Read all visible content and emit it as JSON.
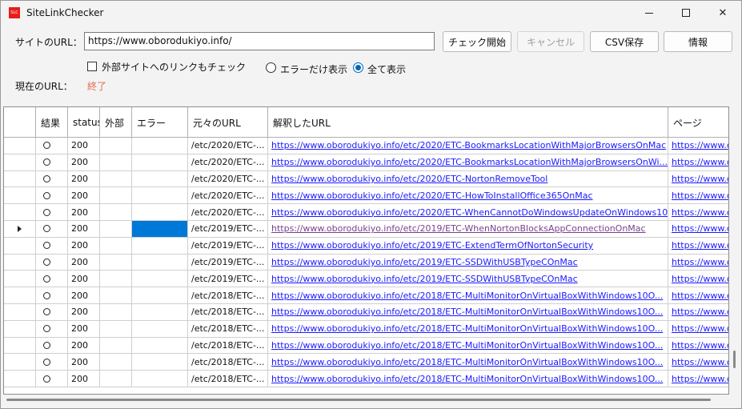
{
  "window": {
    "title": "SiteLinkChecker",
    "icon_text": "SLC"
  },
  "controls": {
    "site_url_label": "サイトのURL：",
    "site_url_value": "https://www.oborodukiyo.info/",
    "buttons": {
      "start": "チェック開始",
      "cancel": "キャンセル",
      "csv": "CSV保存",
      "info": "情報"
    },
    "external_check_label": "外部サイトへのリンクもチェック",
    "external_check_checked": false,
    "radio_errors_only": "エラーだけ表示",
    "radio_show_all": "全て表示",
    "selected_filter": "show_all",
    "current_url_label": "現在のURL：",
    "current_url_value": "終了"
  },
  "grid": {
    "columns": [
      "",
      "結果",
      "status",
      "外部",
      "エラー",
      "元々のURL",
      "解釈したURL",
      "ページ"
    ],
    "rows": [
      {
        "status": "200",
        "orig": "/etc/2020/ETC-...",
        "url": "https://www.oborodukiyo.info/etc/2020/ETC-BookmarksLocationWithMajorBrowsersOnMac",
        "page": "https://www.o"
      },
      {
        "status": "200",
        "orig": "/etc/2020/ETC-...",
        "url": "https://www.oborodukiyo.info/etc/2020/ETC-BookmarksLocationWithMajorBrowsersOnWi...",
        "page": "https://www.o"
      },
      {
        "status": "200",
        "orig": "/etc/2020/ETC-...",
        "url": "https://www.oborodukiyo.info/etc/2020/ETC-NortonRemoveTool",
        "page": "https://www.o"
      },
      {
        "status": "200",
        "orig": "/etc/2020/ETC-...",
        "url": "https://www.oborodukiyo.info/etc/2020/ETC-HowToInstallOffice365OnMac",
        "page": "https://www.o"
      },
      {
        "status": "200",
        "orig": "/etc/2020/ETC-...",
        "url": "https://www.oborodukiyo.info/etc/2020/ETC-WhenCannotDoWindowsUpdateOnWindows10",
        "page": "https://www.o"
      },
      {
        "status": "200",
        "orig": "/etc/2019/ETC-...",
        "url": "https://www.oborodukiyo.info/etc/2019/ETC-WhenNortonBlocksAppConnectionOnMac",
        "page": "https://www.o",
        "current": true
      },
      {
        "status": "200",
        "orig": "/etc/2019/ETC-...",
        "url": "https://www.oborodukiyo.info/etc/2019/ETC-ExtendTermOfNortonSecurity",
        "page": "https://www.o"
      },
      {
        "status": "200",
        "orig": "/etc/2019/ETC-...",
        "url": "https://www.oborodukiyo.info/etc/2019/ETC-SSDWithUSBTypeCOnMac",
        "page": "https://www.o"
      },
      {
        "status": "200",
        "orig": "/etc/2019/ETC-...",
        "url": "https://www.oborodukiyo.info/etc/2019/ETC-SSDWithUSBTypeCOnMac",
        "page": "https://www.o"
      },
      {
        "status": "200",
        "orig": "/etc/2018/ETC-...",
        "url": "https://www.oborodukiyo.info/etc/2018/ETC-MultiMonitorOnVirtualBoxWithWindows10O...",
        "page": "https://www.o"
      },
      {
        "status": "200",
        "orig": "/etc/2018/ETC-...",
        "url": "https://www.oborodukiyo.info/etc/2018/ETC-MultiMonitorOnVirtualBoxWithWindows10O...",
        "page": "https://www.o"
      },
      {
        "status": "200",
        "orig": "/etc/2018/ETC-...",
        "url": "https://www.oborodukiyo.info/etc/2018/ETC-MultiMonitorOnVirtualBoxWithWindows10O...",
        "page": "https://www.o"
      },
      {
        "status": "200",
        "orig": "/etc/2018/ETC-...",
        "url": "https://www.oborodukiyo.info/etc/2018/ETC-MultiMonitorOnVirtualBoxWithWindows10O...",
        "page": "https://www.o"
      },
      {
        "status": "200",
        "orig": "/etc/2018/ETC-...",
        "url": "https://www.oborodukiyo.info/etc/2018/ETC-MultiMonitorOnVirtualBoxWithWindows10O...",
        "page": "https://www.o"
      },
      {
        "status": "200",
        "orig": "/etc/2018/ETC-...",
        "url": "https://www.oborodukiyo.info/etc/2018/ETC-MultiMonitorOnVirtualBoxWithWindows10O...",
        "page": "https://www.o"
      }
    ]
  },
  "colors": {
    "link": "#1a1aff",
    "visited_link": "#7b3f8e",
    "selection": "#0078d7",
    "status_text": "#e06c4c",
    "radio_accent": "#0067c0"
  }
}
